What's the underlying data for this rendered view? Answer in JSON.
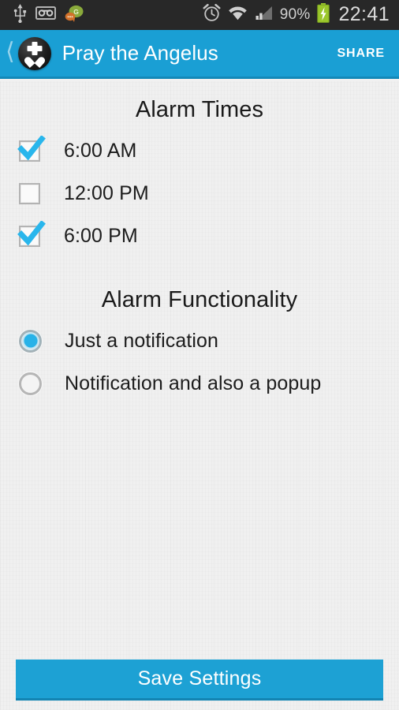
{
  "statusbar": {
    "left_icons": [
      "usb-icon",
      "voicemail-icon",
      "go-chat-icon"
    ],
    "right_icons": [
      "alarm-clock-icon",
      "wifi-icon",
      "signal-icon",
      "battery-charging-icon"
    ],
    "battery_percent": "90%",
    "clock": "22:41",
    "background_color": "#282828"
  },
  "actionbar": {
    "back_icon": "back-chevron-icon",
    "app_icon": "cross-heart-logo-icon",
    "title": "Pray the Angelus",
    "share_label": "SHARE",
    "background_color": "#1a9fd4"
  },
  "alarm_times": {
    "heading": "Alarm Times",
    "items": [
      {
        "label": "6:00 AM",
        "checked": true
      },
      {
        "label": "12:00 PM",
        "checked": false
      },
      {
        "label": "6:00 PM",
        "checked": true
      }
    ]
  },
  "alarm_functionality": {
    "heading": "Alarm Functionality",
    "options": [
      {
        "label": "Just a notification",
        "selected": true
      },
      {
        "label": "Notification and also a popup",
        "selected": false
      }
    ]
  },
  "footer": {
    "save_label": "Save Settings",
    "accent_color": "#1da1d4"
  }
}
